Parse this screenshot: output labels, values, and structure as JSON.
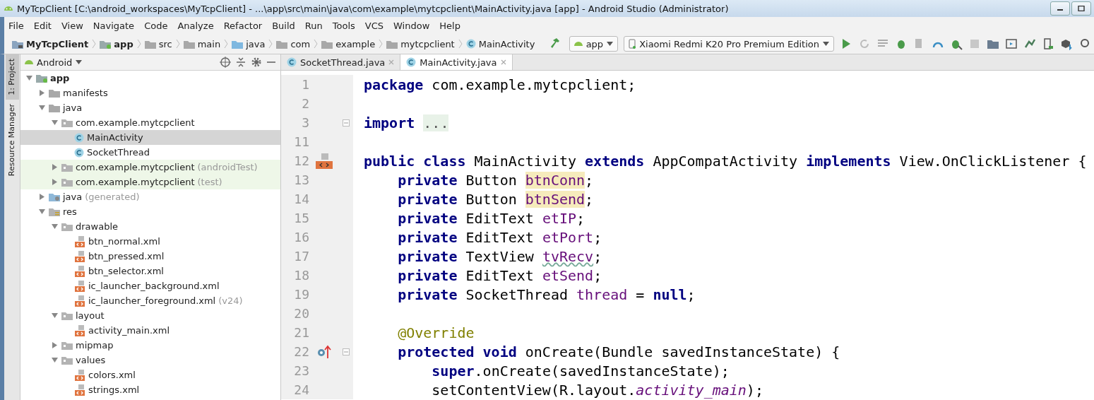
{
  "window": {
    "title": "MyTcpClient [C:\\android_workspaces\\MyTcpClient] - ...\\app\\src\\main\\java\\com\\example\\mytcpclient\\MainActivity.java [app] - Android Studio (Administrator)"
  },
  "menu": [
    "File",
    "Edit",
    "View",
    "Navigate",
    "Code",
    "Analyze",
    "Refactor",
    "Build",
    "Run",
    "Tools",
    "VCS",
    "Window",
    "Help"
  ],
  "breadcrumbs": [
    {
      "label": "MyTcpClient",
      "kind": "project"
    },
    {
      "label": "app",
      "kind": "module"
    },
    {
      "label": "src",
      "kind": "folder"
    },
    {
      "label": "main",
      "kind": "folder"
    },
    {
      "label": "java",
      "kind": "source"
    },
    {
      "label": "com",
      "kind": "folder"
    },
    {
      "label": "example",
      "kind": "folder"
    },
    {
      "label": "mytcpclient",
      "kind": "folder"
    },
    {
      "label": "MainActivity",
      "kind": "class"
    }
  ],
  "run_config": "app",
  "device": "Xiaomi Redmi K20 Pro Premium Edition",
  "side_tabs": [
    {
      "label": "1: Project",
      "selected": true
    },
    {
      "label": "Resource Manager",
      "selected": false
    }
  ],
  "project_view": "Android",
  "tree": [
    {
      "label": "app",
      "kind": "module",
      "expanded": true,
      "selected": false,
      "children": [
        {
          "label": "manifests",
          "kind": "folder",
          "expanded": false,
          "selected": false
        },
        {
          "label": "java",
          "kind": "folder",
          "expanded": true,
          "selected": false,
          "children": [
            {
              "label": "com.example.mytcpclient",
              "kind": "package",
              "expanded": true,
              "selected": false,
              "children": [
                {
                  "label": "MainActivity",
                  "kind": "class",
                  "selected": true
                },
                {
                  "label": "SocketThread",
                  "kind": "class",
                  "selected": false
                }
              ]
            },
            {
              "label": "com.example.mytcpclient",
              "suffix": "(androidTest)",
              "kind": "package",
              "test": true,
              "expanded": false,
              "selected": false
            },
            {
              "label": "com.example.mytcpclient",
              "suffix": "(test)",
              "kind": "package",
              "test": true,
              "expanded": false,
              "selected": false
            }
          ]
        },
        {
          "label": "java",
          "suffix": "(generated)",
          "kind": "generated",
          "expanded": false,
          "selected": false
        },
        {
          "label": "res",
          "kind": "res",
          "expanded": true,
          "selected": false,
          "children": [
            {
              "label": "drawable",
              "kind": "package",
              "expanded": true,
              "selected": false,
              "children": [
                {
                  "label": "btn_normal.xml",
                  "kind": "xml",
                  "selected": false
                },
                {
                  "label": "btn_pressed.xml",
                  "kind": "xml",
                  "selected": false
                },
                {
                  "label": "btn_selector.xml",
                  "kind": "xml",
                  "selected": false
                },
                {
                  "label": "ic_launcher_background.xml",
                  "kind": "xml",
                  "selected": false
                },
                {
                  "label": "ic_launcher_foreground.xml",
                  "suffix": "(v24)",
                  "kind": "xml",
                  "selected": false
                }
              ]
            },
            {
              "label": "layout",
              "kind": "package",
              "expanded": true,
              "selected": false,
              "children": [
                {
                  "label": "activity_main.xml",
                  "kind": "xml",
                  "selected": false
                }
              ]
            },
            {
              "label": "mipmap",
              "kind": "package",
              "expanded": false,
              "selected": false
            },
            {
              "label": "values",
              "kind": "package",
              "expanded": true,
              "selected": false,
              "children": [
                {
                  "label": "colors.xml",
                  "kind": "xml",
                  "selected": false
                },
                {
                  "label": "strings.xml",
                  "kind": "xml",
                  "selected": false
                }
              ]
            }
          ]
        }
      ]
    }
  ],
  "editor_tabs": [
    {
      "label": "SocketThread.java",
      "selected": false
    },
    {
      "label": "MainActivity.java",
      "selected": true
    }
  ],
  "code": [
    {
      "number": "1",
      "tokens": [
        {
          "kind": "kw",
          "text": "package"
        },
        {
          "kind": "plain",
          "text": " com.example.mytcpclient;"
        }
      ]
    },
    {
      "number": "2"
    },
    {
      "number": "3",
      "fold": true,
      "tokens": [
        {
          "kind": "kw",
          "text": "import "
        },
        {
          "kind": "folded",
          "text": "..."
        }
      ]
    },
    {
      "number": "11"
    },
    {
      "number": "12",
      "layout_marker": true,
      "tokens": [
        {
          "kind": "kw",
          "text": "public class"
        },
        {
          "kind": "plain",
          "text": " MainActivity "
        },
        {
          "kind": "kw",
          "text": "extends"
        },
        {
          "kind": "plain",
          "text": " AppCompatActivity "
        },
        {
          "kind": "kw",
          "text": "implements"
        },
        {
          "kind": "plain",
          "text": " View.OnClickListener {"
        }
      ]
    },
    {
      "number": "13",
      "tokens": [
        {
          "kind": "kw",
          "text": "    private"
        },
        {
          "kind": "plain",
          "text": " Button "
        },
        {
          "kind": "usage",
          "text": "btnConn"
        },
        {
          "kind": "plain",
          "text": ";"
        }
      ]
    },
    {
      "number": "14",
      "tokens": [
        {
          "kind": "kw",
          "text": "    private"
        },
        {
          "kind": "plain",
          "text": " Button "
        },
        {
          "kind": "usage",
          "text": "btnSend"
        },
        {
          "kind": "plain",
          "text": ";"
        }
      ]
    },
    {
      "number": "15",
      "tokens": [
        {
          "kind": "kw",
          "text": "    private"
        },
        {
          "kind": "plain",
          "text": " EditText "
        },
        {
          "kind": "field",
          "text": "etIP"
        },
        {
          "kind": "plain",
          "text": ";"
        }
      ]
    },
    {
      "number": "16",
      "tokens": [
        {
          "kind": "kw",
          "text": "    private"
        },
        {
          "kind": "plain",
          "text": " EditText "
        },
        {
          "kind": "field",
          "text": "etPort"
        },
        {
          "kind": "plain",
          "text": ";"
        }
      ]
    },
    {
      "number": "17",
      "tokens": [
        {
          "kind": "kw",
          "text": "    private"
        },
        {
          "kind": "plain",
          "text": " TextView "
        },
        {
          "kind": "typo",
          "text": "tvRecv"
        },
        {
          "kind": "plain",
          "text": ";"
        }
      ]
    },
    {
      "number": "18",
      "tokens": [
        {
          "kind": "kw",
          "text": "    private"
        },
        {
          "kind": "plain",
          "text": " EditText "
        },
        {
          "kind": "field",
          "text": "etSend"
        },
        {
          "kind": "plain",
          "text": ";"
        }
      ]
    },
    {
      "number": "19",
      "tokens": [
        {
          "kind": "kw",
          "text": "    private"
        },
        {
          "kind": "plain",
          "text": " SocketThread "
        },
        {
          "kind": "field",
          "text": "thread"
        },
        {
          "kind": "plain",
          "text": " = "
        },
        {
          "kind": "kw",
          "text": "null"
        },
        {
          "kind": "plain",
          "text": ";"
        }
      ]
    },
    {
      "number": "20"
    },
    {
      "number": "21",
      "tokens": [
        {
          "kind": "annot",
          "text": "    @Override"
        }
      ]
    },
    {
      "number": "22",
      "override_marker": true,
      "fold": true,
      "tokens": [
        {
          "kind": "kw",
          "text": "    protected void"
        },
        {
          "kind": "plain",
          "text": " onCreate(Bundle savedInstanceState) {"
        }
      ]
    },
    {
      "number": "23",
      "tokens": [
        {
          "kind": "kw",
          "text": "        super"
        },
        {
          "kind": "plain",
          "text": ".onCreate(savedInstanceState);"
        }
      ]
    },
    {
      "number": "24",
      "tokens": [
        {
          "kind": "plain",
          "text": "        setContentView(R.layout."
        },
        {
          "kind": "static",
          "text": "activity_main"
        },
        {
          "kind": "plain",
          "text": ");"
        }
      ]
    }
  ]
}
